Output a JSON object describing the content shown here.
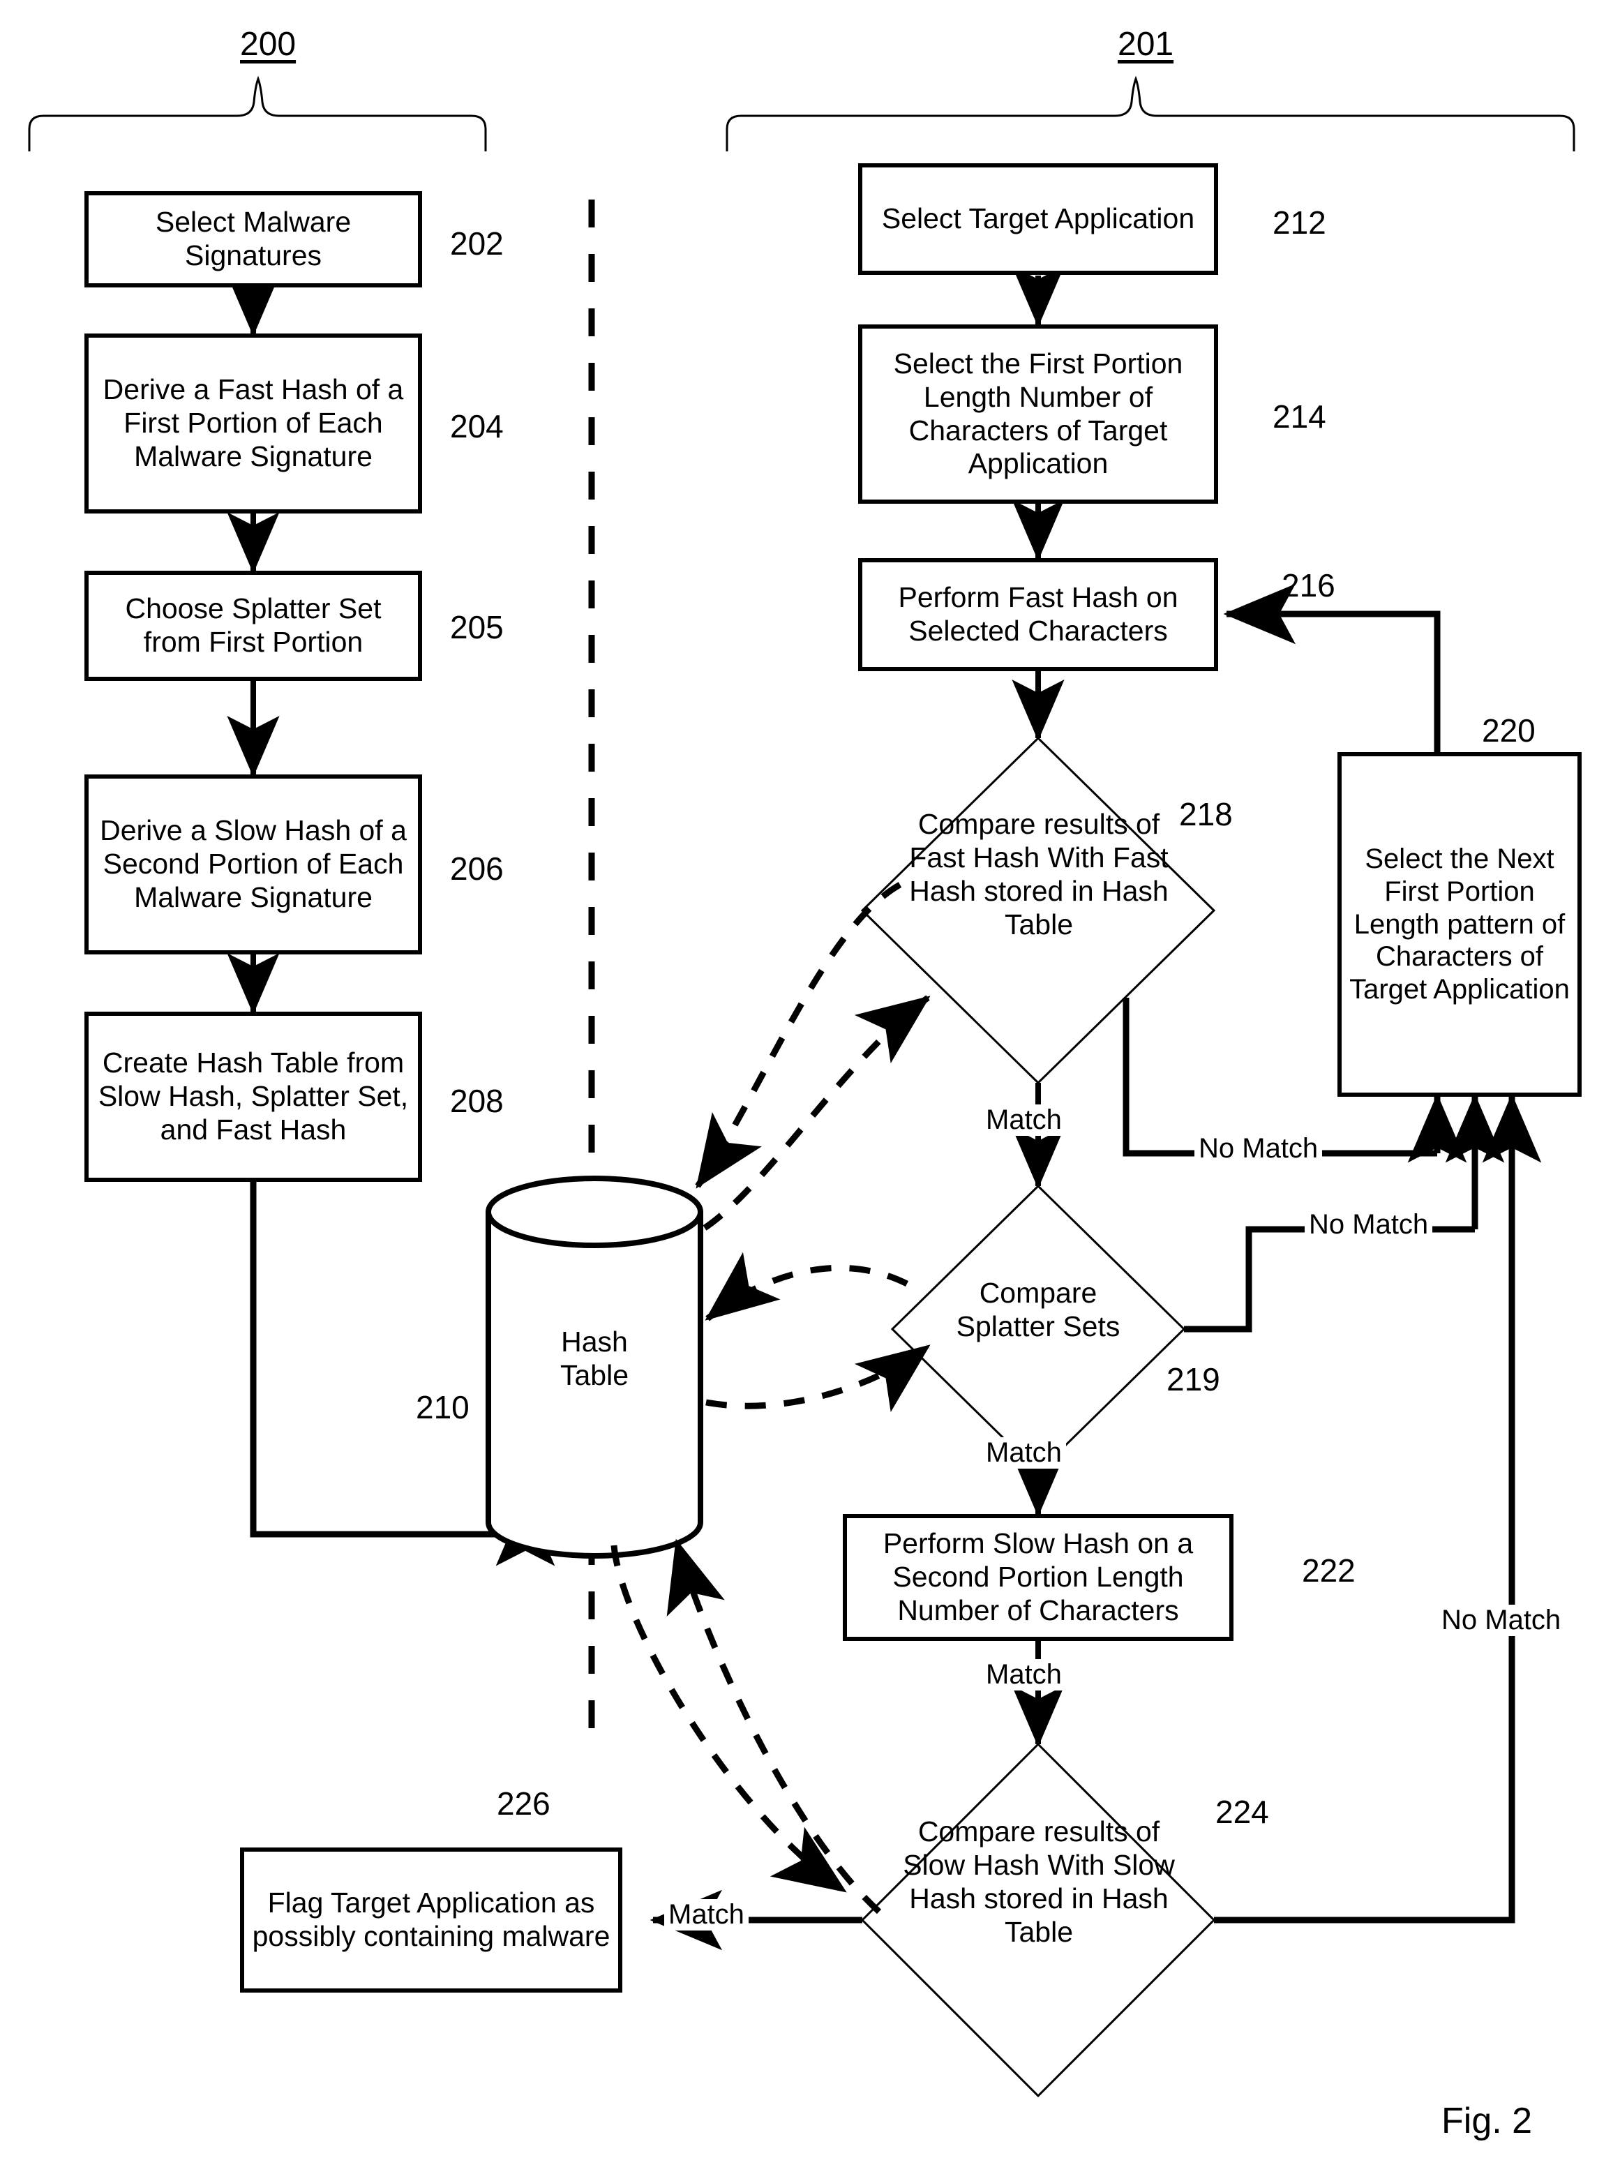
{
  "figure": {
    "caption": "Fig. 2",
    "group_labels": {
      "left": "200",
      "right": "201"
    }
  },
  "left_column": {
    "title_ref": "200",
    "steps": [
      {
        "ref": "202",
        "text": "Select Malware Signatures"
      },
      {
        "ref": "204",
        "text": "Derive a Fast Hash of a First Portion of Each Malware Signature"
      },
      {
        "ref": "205",
        "text": "Choose Splatter Set from First Portion"
      },
      {
        "ref": "206",
        "text": "Derive a Slow Hash of a Second Portion of Each Malware Signature"
      },
      {
        "ref": "208",
        "text": "Create Hash Table from Slow Hash, Splatter Set, and Fast Hash"
      }
    ]
  },
  "datastore": {
    "ref": "210",
    "label_line1": "Hash",
    "label_line2": "Table"
  },
  "right_column": {
    "title_ref": "201",
    "steps": [
      {
        "ref": "212",
        "text": "Select Target Application"
      },
      {
        "ref": "214",
        "text": "Select the First Portion Length Number of Characters of Target Application"
      },
      {
        "ref": "216",
        "text": "Perform Fast Hash on Selected Characters"
      },
      {
        "ref": "220",
        "text": "Select the Next First Portion Length pattern of Characters of Target Application"
      },
      {
        "ref": "222",
        "text": "Perform Slow Hash on a Second Portion Length Number of Characters"
      },
      {
        "ref": "226",
        "text": "Flag Target Application as possibly containing malware"
      }
    ],
    "decisions": [
      {
        "ref": "218",
        "text": "Compare results of Fast Hash With Fast Hash stored in Hash Table"
      },
      {
        "ref": "219",
        "text": "Compare Splatter Sets"
      },
      {
        "ref": "224",
        "text": "Compare results of Slow Hash With Slow Hash stored in Hash Table"
      }
    ]
  },
  "edge_labels": {
    "match_218": "Match",
    "no_match_218": "No Match",
    "no_match_219": "No Match",
    "match_219": "Match",
    "match_222": "Match",
    "no_match_224": "No Match",
    "match_224": "Match"
  },
  "colors": {
    "stroke": "#000000",
    "background": "#ffffff"
  }
}
